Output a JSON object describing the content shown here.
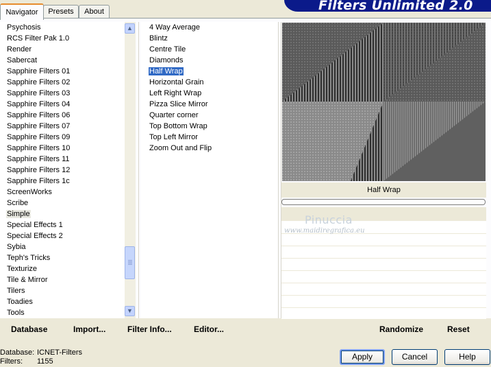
{
  "tabs": [
    "Navigator",
    "Presets",
    "About"
  ],
  "app_title": "Filters Unlimited 2.0",
  "categories": [
    "Psychosis",
    "RCS Filter Pak 1.0",
    "Render",
    "Sabercat",
    "Sapphire Filters 01",
    "Sapphire Filters 02",
    "Sapphire Filters 03",
    "Sapphire Filters 04",
    "Sapphire Filters 06",
    "Sapphire Filters 07",
    "Sapphire Filters 09",
    "Sapphire Filters 10",
    "Sapphire Filters 11",
    "Sapphire Filters 12",
    "Sapphire Filters 1c",
    "ScreenWorks",
    "Scribe",
    "Simple",
    "Special Effects 1",
    "Special Effects 2",
    "Sybia",
    "Teph's Tricks",
    "Texturize",
    "Tile & Mirror",
    "Tilers",
    "Toadies",
    "Tools"
  ],
  "selected_category": "Simple",
  "filters": [
    "4 Way Average",
    "Blintz",
    "Centre Tile",
    "Diamonds",
    "Half Wrap",
    "Horizontal Grain",
    "Left Right Wrap",
    "Pizza Slice Mirror",
    "Quarter corner",
    "Top Bottom Wrap",
    "Top Left Mirror",
    "Zoom Out and Flip"
  ],
  "selected_filter": "Half Wrap",
  "preview": {
    "filter_label": "Half Wrap"
  },
  "watermark": {
    "name": "Pinuccia",
    "site": "www.maidiregrafica.eu"
  },
  "links": {
    "database": "Database",
    "import": "Import...",
    "filter_info": "Filter Info...",
    "editor": "Editor...",
    "randomize": "Randomize",
    "reset": "Reset"
  },
  "status": {
    "database_label": "Database:",
    "database_value": "ICNET-Filters",
    "filters_label": "Filters:",
    "filters_value": "1155"
  },
  "buttons": {
    "apply": "Apply",
    "cancel": "Cancel",
    "help": "Help"
  },
  "colors": {
    "selection": "#316ac5",
    "title_banner": "#0b1a8a",
    "background": "#ece9d8"
  }
}
